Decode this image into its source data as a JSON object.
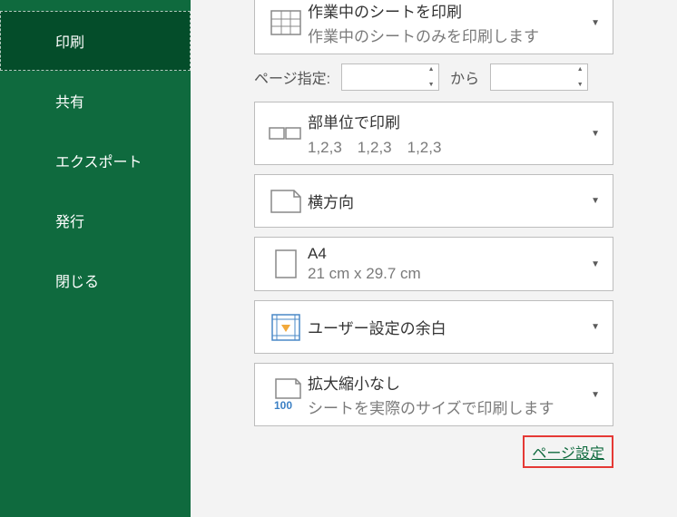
{
  "sidebar": {
    "items": [
      {
        "label": "印刷"
      },
      {
        "label": "共有"
      },
      {
        "label": "エクスポート"
      },
      {
        "label": "発行"
      },
      {
        "label": "閉じる"
      }
    ]
  },
  "settings": {
    "print_target": {
      "title": "作業中のシートを印刷",
      "subtitle": "作業中のシートのみを印刷します"
    },
    "page_range": {
      "label": "ページ指定:",
      "to_label": "から"
    },
    "collate": {
      "title": "部単位で印刷",
      "subtitle": "1,2,3　1,2,3　1,2,3"
    },
    "orientation": {
      "title": "横方向"
    },
    "paper": {
      "title": "A4",
      "subtitle": "21 cm x 29.7 cm"
    },
    "margins": {
      "title": "ユーザー設定の余白"
    },
    "scaling": {
      "title": "拡大縮小なし",
      "subtitle": "シートを実際のサイズで印刷します",
      "icon_text": "100"
    },
    "page_setup_link": "ページ設定"
  }
}
